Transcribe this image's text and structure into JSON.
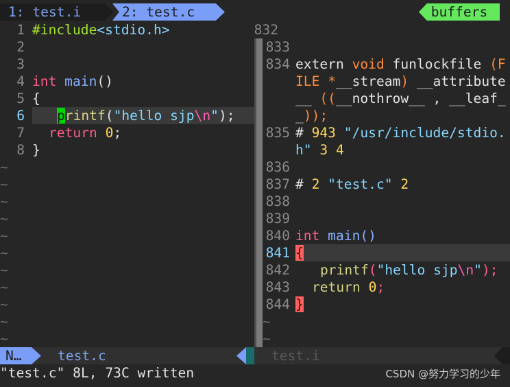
{
  "tabline": {
    "tab1": "1: test.i",
    "tab2": "2: test.c",
    "buffers_label": "buffers"
  },
  "left_pane": {
    "lines": [
      {
        "n": "1"
      },
      {
        "n": "2"
      },
      {
        "n": "3"
      },
      {
        "n": "4"
      },
      {
        "n": "5"
      },
      {
        "n": "6"
      },
      {
        "n": "7"
      },
      {
        "n": "8"
      }
    ],
    "code": {
      "l1_include": "#include",
      "l1_header": "<stdio.h>",
      "l4_int": "int",
      "l4_main": " main",
      "l4_parens": "()",
      "l5_brace": "{",
      "l6_cursor": "p",
      "l6_fn": "rintf",
      "l6_open": "(",
      "l6_str1": "\"hello sjp",
      "l6_esc": "\\n",
      "l6_str2": "\"",
      "l6_close": ");",
      "l7_return": "return",
      "l7_zero": " 0",
      "l7_semi": ";",
      "l8_brace": "}"
    },
    "tilde": "~"
  },
  "right_pane": {
    "top_num": "832",
    "nums": {
      "n833": "833",
      "n834": "834",
      "n835": "835",
      "n836": "836",
      "n837": "837",
      "n838": "838",
      "n839": "839",
      "n840": "840",
      "n841": "841",
      "n842": "842",
      "n843": "843",
      "n844": "844"
    },
    "code": {
      "l834a_extern": "extern ",
      "l834a_void": "void",
      "l834a_fn": " funlockfile ",
      "l834a_paren": "(F",
      "l834b_ile": "ILE ",
      "l834b_star": "*",
      "l834b_stream": "__stream",
      "l834b_close": ")",
      "l834b_attr": " __attribute",
      "l834c_uu": "__ ",
      "l834c_pp": "((",
      "l834c_nothrow": "__nothrow__ , __leaf_",
      "l834d_end": "_",
      "l834d_close": "));",
      "l835_hash": "# ",
      "l835_num": "943",
      "l835_path": " \"/usr/include/stdio.",
      "l835b_h": "h\"",
      "l835b_nums": " 3 4",
      "l837_hash": "# ",
      "l837_num": "2",
      "l837_file": " \"test.c\"",
      "l837_num2": " 2",
      "l840_int": "int",
      "l840_main": " main",
      "l840_parens": "()",
      "l841_brace": "{",
      "l842_fn": "printf",
      "l842_open": "(",
      "l842_str1": "\"hello sjp",
      "l842_esc": "\\n",
      "l842_str2": "\"",
      "l842_close": ");",
      "l843_return": "return",
      "l843_zero": " 0",
      "l843_semi": ";",
      "l844_brace": "}"
    },
    "tilde": "~"
  },
  "statusline": {
    "mode": "N…",
    "left_file": "test.c",
    "right_file": "test.i"
  },
  "cmdline": "\"test.c\" 8L, 73C written",
  "watermark": "CSDN @努力学习的少年"
}
